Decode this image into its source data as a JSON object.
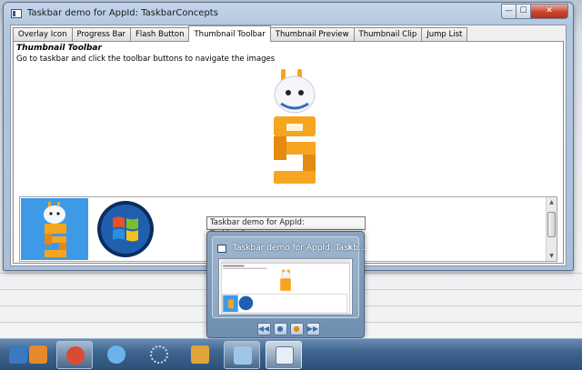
{
  "window": {
    "title": "Taskbar demo for AppId: TaskbarConcepts",
    "caption_buttons": {
      "minimize": "—",
      "maximize": "☐",
      "close": "✕"
    }
  },
  "tabs": [
    {
      "label": "Overlay Icon"
    },
    {
      "label": "Progress Bar"
    },
    {
      "label": "Flash Button"
    },
    {
      "label": "Thumbnail Toolbar",
      "active": true
    },
    {
      "label": "Thumbnail Preview"
    },
    {
      "label": "Thumbnail Clip"
    },
    {
      "label": "Jump List"
    }
  ],
  "panel": {
    "heading": "Thumbnail Toolbar",
    "description": "Go to taskbar and click the toolbar buttons to navigate the images"
  },
  "thumbnails": [
    {
      "name": "robot-image",
      "selected": true
    },
    {
      "name": "windows-logo-image",
      "selected": false
    }
  ],
  "tooltip": {
    "text": "Taskbar demo for AppId: TaskbarConcepts"
  },
  "preview": {
    "title": "Taskbar demo for AppId: Taskb...",
    "close": "✕",
    "toolbar": [
      {
        "name": "first-button",
        "glyph": "◀◀"
      },
      {
        "name": "previous-button",
        "glyph": "●"
      },
      {
        "name": "next-button",
        "glyph": "●"
      },
      {
        "name": "last-button",
        "glyph": "▶▶"
      }
    ]
  },
  "taskbar": {
    "items": [
      {
        "name": "taskbar-item-1",
        "color": "#3a79c0"
      },
      {
        "name": "taskbar-item-outlook",
        "color": "#e6892b"
      },
      {
        "name": "taskbar-item-infinity",
        "color": "#d94b35",
        "active": true
      },
      {
        "name": "taskbar-item-loop",
        "color": "#6bb3e8"
      },
      {
        "name": "taskbar-item-dots",
        "color": "#cfd8e4"
      },
      {
        "name": "taskbar-item-office",
        "color": "#e2a43a"
      },
      {
        "name": "taskbar-item-tool",
        "color": "#9fc6e9",
        "active": true
      },
      {
        "name": "taskbar-item-taskbar-demo",
        "color": "#e8eef6",
        "highlighted": true
      }
    ]
  },
  "colors": {
    "accent_blue": "#3e9ae6",
    "robot_orange": "#f6a521",
    "taskbar": "#3f6690"
  }
}
